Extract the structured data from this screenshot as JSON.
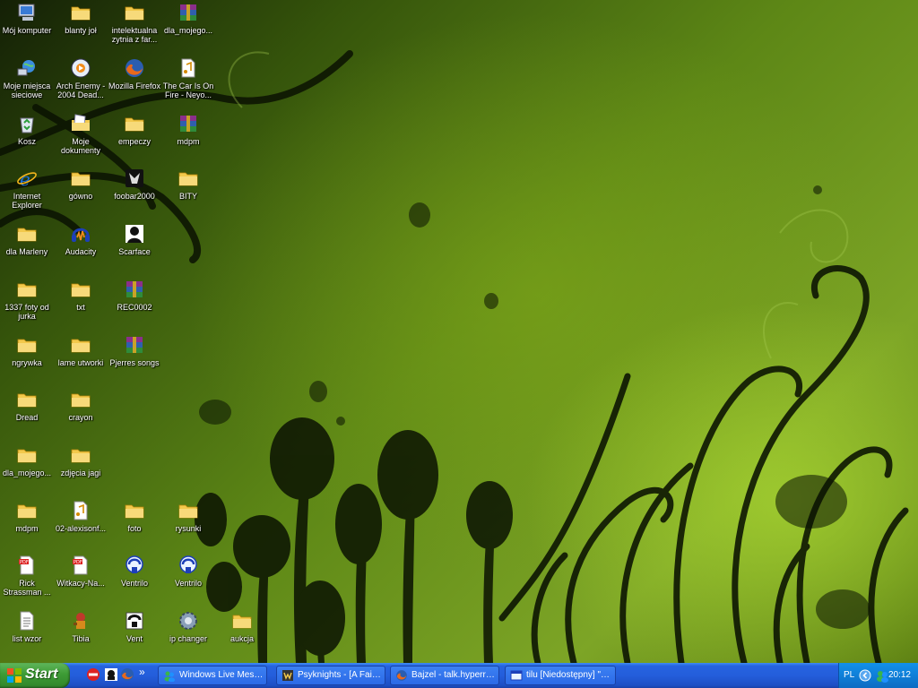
{
  "desktop": {
    "icons": [
      {
        "label": "Mój komputer",
        "icon": "my-computer-icon"
      },
      {
        "label": "blanty joł",
        "icon": "folder-icon"
      },
      {
        "label": "intelektualna zytnia z far...",
        "icon": "folder-icon"
      },
      {
        "label": "dla_mojego...",
        "icon": "winrar-archive-icon"
      },
      {
        "label": "Moje miejsca sieciowe",
        "icon": "network-places-icon"
      },
      {
        "label": "Arch Enemy - 2004 Dead...",
        "icon": "media-file-icon"
      },
      {
        "label": "Mozilla Firefox",
        "icon": "firefox-icon"
      },
      {
        "label": "The Car Is On Fire - Neyo...",
        "icon": "audio-file-icon"
      },
      {
        "label": "Kosz",
        "icon": "recycle-bin-icon"
      },
      {
        "label": "Moje dokumenty",
        "icon": "my-documents-icon"
      },
      {
        "label": "empeczy",
        "icon": "folder-icon"
      },
      {
        "label": "mdpm",
        "icon": "winrar-archive-icon"
      },
      {
        "label": "Internet Explorer",
        "icon": "internet-explorer-icon"
      },
      {
        "label": "gówno",
        "icon": "folder-icon"
      },
      {
        "label": "foobar2000",
        "icon": "foobar2000-icon"
      },
      {
        "label": "BITY",
        "icon": "folder-icon"
      },
      {
        "label": "dla Marleny",
        "icon": "folder-icon"
      },
      {
        "label": "Audacity",
        "icon": "audacity-icon"
      },
      {
        "label": "Scarface",
        "icon": "scarface-game-icon"
      },
      {
        "label": "1337 foty od jurka",
        "icon": "folder-icon"
      },
      {
        "label": "txt",
        "icon": "folder-icon"
      },
      {
        "label": "REC0002",
        "icon": "winrar-archive-icon"
      },
      {
        "label": "ngrywka",
        "icon": "folder-icon"
      },
      {
        "label": "lame utworki",
        "icon": "folder-icon"
      },
      {
        "label": "Pjerres songs",
        "icon": "winrar-archive-icon"
      },
      {
        "label": "Dread",
        "icon": "folder-icon"
      },
      {
        "label": "crayon",
        "icon": "folder-icon"
      },
      {
        "label": "dla_mojego...",
        "icon": "folder-icon"
      },
      {
        "label": "zdjęcia jagi",
        "icon": "folder-icon"
      },
      {
        "label": "mdpm",
        "icon": "folder-icon"
      },
      {
        "label": "02-alexisonf...",
        "icon": "audio-file-icon"
      },
      {
        "label": "foto",
        "icon": "folder-icon"
      },
      {
        "label": "rysunki",
        "icon": "folder-icon"
      },
      {
        "label": "Rick Strassman ...",
        "icon": "pdf-file-icon"
      },
      {
        "label": "Witkacy-Na...",
        "icon": "pdf-file-icon"
      },
      {
        "label": "Ventrilo",
        "icon": "ventrilo-icon"
      },
      {
        "label": "Ventrilo",
        "icon": "ventrilo-icon"
      },
      {
        "label": "list wzor",
        "icon": "text-document-icon"
      },
      {
        "label": "Tibia",
        "icon": "tibia-game-icon"
      },
      {
        "label": "Vent",
        "icon": "vent-icon"
      },
      {
        "label": "ip changer",
        "icon": "ip-changer-icon"
      },
      {
        "label": "aukcja",
        "icon": "folder-icon"
      }
    ]
  },
  "taskbar": {
    "start_label": "Start",
    "quick_launch": [
      {
        "icon": "no-entry-icon"
      },
      {
        "icon": "scarface-icon"
      },
      {
        "icon": "firefox-icon"
      }
    ],
    "overflow_label": "»",
    "tasks": [
      {
        "label": "Windows Live Messen...",
        "icon": "messenger-icon"
      },
      {
        "label": "Psyknights - [A Faint ...",
        "icon": "winamp-icon"
      },
      {
        "label": "Bajzel - talk.hyperrea...",
        "icon": "firefox-icon"
      },
      {
        "label": "tilu [Niedostępny] \"w...",
        "icon": "chat-window-icon"
      }
    ],
    "tray": {
      "language": "PL",
      "clock": "20:12",
      "icons": [
        "show-hidden-icons-chevron-icon",
        "messenger-tray-icon"
      ]
    }
  },
  "colors": {
    "wallpaper_green": "#6b9a1c",
    "taskbar_blue": "#245edb",
    "start_green": "#3d9b35",
    "tray_blue": "#0f7fd8"
  }
}
